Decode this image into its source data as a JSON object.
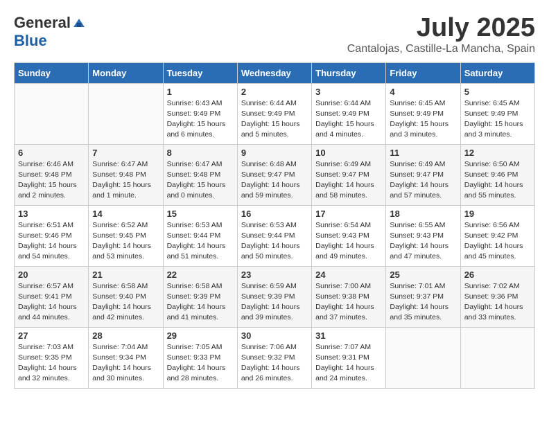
{
  "logo": {
    "general": "General",
    "blue": "Blue"
  },
  "title": {
    "month": "July 2025",
    "location": "Cantalojas, Castille-La Mancha, Spain"
  },
  "headers": [
    "Sunday",
    "Monday",
    "Tuesday",
    "Wednesday",
    "Thursday",
    "Friday",
    "Saturday"
  ],
  "weeks": [
    [
      {
        "day": "",
        "info": ""
      },
      {
        "day": "",
        "info": ""
      },
      {
        "day": "1",
        "info": "Sunrise: 6:43 AM\nSunset: 9:49 PM\nDaylight: 15 hours\nand 6 minutes."
      },
      {
        "day": "2",
        "info": "Sunrise: 6:44 AM\nSunset: 9:49 PM\nDaylight: 15 hours\nand 5 minutes."
      },
      {
        "day": "3",
        "info": "Sunrise: 6:44 AM\nSunset: 9:49 PM\nDaylight: 15 hours\nand 4 minutes."
      },
      {
        "day": "4",
        "info": "Sunrise: 6:45 AM\nSunset: 9:49 PM\nDaylight: 15 hours\nand 3 minutes."
      },
      {
        "day": "5",
        "info": "Sunrise: 6:45 AM\nSunset: 9:49 PM\nDaylight: 15 hours\nand 3 minutes."
      }
    ],
    [
      {
        "day": "6",
        "info": "Sunrise: 6:46 AM\nSunset: 9:48 PM\nDaylight: 15 hours\nand 2 minutes."
      },
      {
        "day": "7",
        "info": "Sunrise: 6:47 AM\nSunset: 9:48 PM\nDaylight: 15 hours\nand 1 minute."
      },
      {
        "day": "8",
        "info": "Sunrise: 6:47 AM\nSunset: 9:48 PM\nDaylight: 15 hours\nand 0 minutes."
      },
      {
        "day": "9",
        "info": "Sunrise: 6:48 AM\nSunset: 9:47 PM\nDaylight: 14 hours\nand 59 minutes."
      },
      {
        "day": "10",
        "info": "Sunrise: 6:49 AM\nSunset: 9:47 PM\nDaylight: 14 hours\nand 58 minutes."
      },
      {
        "day": "11",
        "info": "Sunrise: 6:49 AM\nSunset: 9:47 PM\nDaylight: 14 hours\nand 57 minutes."
      },
      {
        "day": "12",
        "info": "Sunrise: 6:50 AM\nSunset: 9:46 PM\nDaylight: 14 hours\nand 55 minutes."
      }
    ],
    [
      {
        "day": "13",
        "info": "Sunrise: 6:51 AM\nSunset: 9:46 PM\nDaylight: 14 hours\nand 54 minutes."
      },
      {
        "day": "14",
        "info": "Sunrise: 6:52 AM\nSunset: 9:45 PM\nDaylight: 14 hours\nand 53 minutes."
      },
      {
        "day": "15",
        "info": "Sunrise: 6:53 AM\nSunset: 9:44 PM\nDaylight: 14 hours\nand 51 minutes."
      },
      {
        "day": "16",
        "info": "Sunrise: 6:53 AM\nSunset: 9:44 PM\nDaylight: 14 hours\nand 50 minutes."
      },
      {
        "day": "17",
        "info": "Sunrise: 6:54 AM\nSunset: 9:43 PM\nDaylight: 14 hours\nand 49 minutes."
      },
      {
        "day": "18",
        "info": "Sunrise: 6:55 AM\nSunset: 9:43 PM\nDaylight: 14 hours\nand 47 minutes."
      },
      {
        "day": "19",
        "info": "Sunrise: 6:56 AM\nSunset: 9:42 PM\nDaylight: 14 hours\nand 45 minutes."
      }
    ],
    [
      {
        "day": "20",
        "info": "Sunrise: 6:57 AM\nSunset: 9:41 PM\nDaylight: 14 hours\nand 44 minutes."
      },
      {
        "day": "21",
        "info": "Sunrise: 6:58 AM\nSunset: 9:40 PM\nDaylight: 14 hours\nand 42 minutes."
      },
      {
        "day": "22",
        "info": "Sunrise: 6:58 AM\nSunset: 9:39 PM\nDaylight: 14 hours\nand 41 minutes."
      },
      {
        "day": "23",
        "info": "Sunrise: 6:59 AM\nSunset: 9:39 PM\nDaylight: 14 hours\nand 39 minutes."
      },
      {
        "day": "24",
        "info": "Sunrise: 7:00 AM\nSunset: 9:38 PM\nDaylight: 14 hours\nand 37 minutes."
      },
      {
        "day": "25",
        "info": "Sunrise: 7:01 AM\nSunset: 9:37 PM\nDaylight: 14 hours\nand 35 minutes."
      },
      {
        "day": "26",
        "info": "Sunrise: 7:02 AM\nSunset: 9:36 PM\nDaylight: 14 hours\nand 33 minutes."
      }
    ],
    [
      {
        "day": "27",
        "info": "Sunrise: 7:03 AM\nSunset: 9:35 PM\nDaylight: 14 hours\nand 32 minutes."
      },
      {
        "day": "28",
        "info": "Sunrise: 7:04 AM\nSunset: 9:34 PM\nDaylight: 14 hours\nand 30 minutes."
      },
      {
        "day": "29",
        "info": "Sunrise: 7:05 AM\nSunset: 9:33 PM\nDaylight: 14 hours\nand 28 minutes."
      },
      {
        "day": "30",
        "info": "Sunrise: 7:06 AM\nSunset: 9:32 PM\nDaylight: 14 hours\nand 26 minutes."
      },
      {
        "day": "31",
        "info": "Sunrise: 7:07 AM\nSunset: 9:31 PM\nDaylight: 14 hours\nand 24 minutes."
      },
      {
        "day": "",
        "info": ""
      },
      {
        "day": "",
        "info": ""
      }
    ]
  ]
}
